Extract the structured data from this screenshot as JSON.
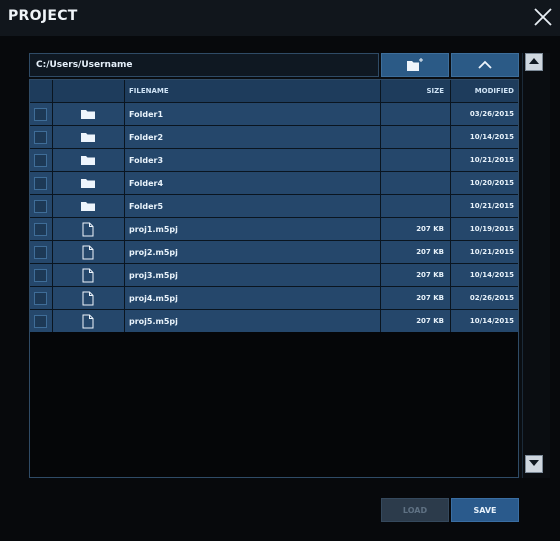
{
  "window": {
    "title": "PROJECT"
  },
  "path": {
    "current": "C:/Users/Username"
  },
  "columns": {
    "filename": "FILENAME",
    "size": "SIZE",
    "modified": "MODIFIED"
  },
  "rows": [
    {
      "type": "folder",
      "icon": "folder-icon",
      "name": "Folder1",
      "size": "",
      "modified": "03/26/2015"
    },
    {
      "type": "folder",
      "icon": "folder-icon",
      "name": "Folder2",
      "size": "",
      "modified": "10/14/2015"
    },
    {
      "type": "folder",
      "icon": "folder-icon",
      "name": "Folder3",
      "size": "",
      "modified": "10/21/2015"
    },
    {
      "type": "folder",
      "icon": "folder-icon",
      "name": "Folder4",
      "size": "",
      "modified": "10/20/2015"
    },
    {
      "type": "folder",
      "icon": "folder-icon",
      "name": "Folder5",
      "size": "",
      "modified": "10/21/2015"
    },
    {
      "type": "file",
      "icon": "file-icon",
      "name": "proj1.m5pj",
      "size": "207 KB",
      "modified": "10/19/2015"
    },
    {
      "type": "file",
      "icon": "file-icon",
      "name": "proj2.m5pj",
      "size": "207 KB",
      "modified": "10/21/2015"
    },
    {
      "type": "file",
      "icon": "file-icon",
      "name": "proj3.m5pj",
      "size": "207 KB",
      "modified": "10/14/2015"
    },
    {
      "type": "file",
      "icon": "file-icon",
      "name": "proj4.m5pj",
      "size": "207 KB",
      "modified": "02/26/2015"
    },
    {
      "type": "file",
      "icon": "file-icon",
      "name": "proj5.m5pj",
      "size": "207 KB",
      "modified": "10/14/2015"
    }
  ],
  "buttons": {
    "load": "LOAD",
    "save": "SAVE",
    "load_enabled": false
  },
  "icons": {
    "close": "close-icon",
    "new_folder": "new-folder-icon",
    "up": "chevron-up-icon",
    "scroll_up": "scroll-up-arrow-icon",
    "scroll_down": "scroll-down-arrow-icon"
  },
  "colors": {
    "accent": "#2a5a8c",
    "row": "#25476b",
    "header": "#1e3c5c",
    "background": "#07090c"
  }
}
